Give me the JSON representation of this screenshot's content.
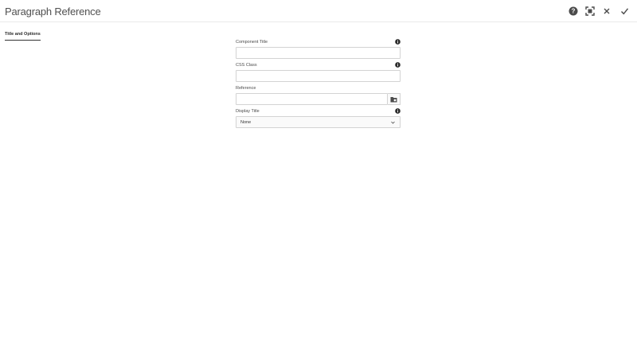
{
  "dialog": {
    "title": "Paragraph Reference",
    "actions": [
      {
        "name": "help-icon"
      },
      {
        "name": "fullscreen-icon"
      },
      {
        "name": "close-icon"
      },
      {
        "name": "checkmark-icon"
      }
    ]
  },
  "tabs": [
    {
      "label": "Title and Options",
      "active": true
    }
  ],
  "form": {
    "component_title": {
      "label": "Component Title",
      "value": "",
      "info_icon": "info-icon"
    },
    "css_class": {
      "label": "CSS Class",
      "value": "",
      "info_icon": "info-icon"
    },
    "reference": {
      "label": "Reference",
      "value": "",
      "browse_icon": "folder-browse-icon"
    },
    "display_title": {
      "label": "Display Title",
      "selected": "None",
      "info_icon": "info-icon"
    }
  },
  "colors": {
    "text": "#4b4b4b",
    "border": "#d3d3d3",
    "icon": "#4b4b4b",
    "tab_underline": "#323232"
  }
}
